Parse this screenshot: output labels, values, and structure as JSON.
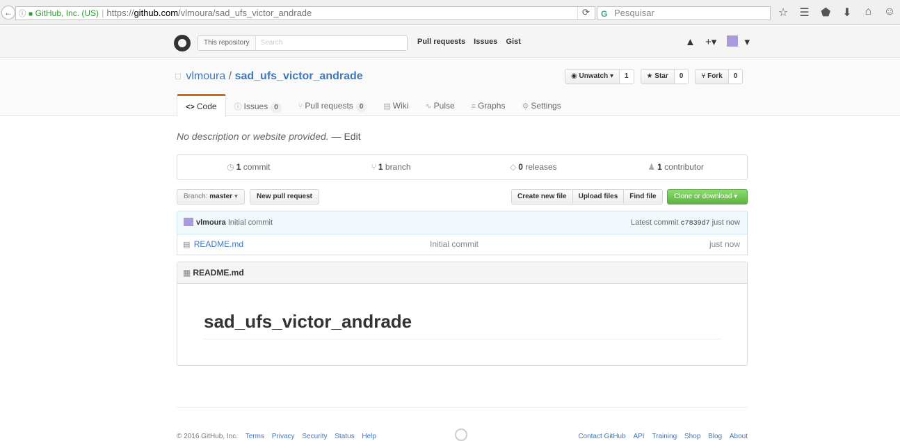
{
  "browser": {
    "back_icon": "back-arrow-icon",
    "info_icon": "ⓘ",
    "lock_icon": "🔒",
    "org": "GitHub, Inc. (US)",
    "url_prefix": "https://",
    "url_host": "github.com",
    "url_path": "/vlmoura/sad_ufs_victor_andrade",
    "reload": "⟳",
    "search_placeholder": "Pesquisar",
    "search_logo": "G",
    "toolbar_icons": [
      "☆",
      "☰",
      "⬟",
      "⬇",
      "⌂",
      "☺"
    ]
  },
  "gh_header": {
    "scope_label": "This repository",
    "search_placeholder": "Search",
    "nav": [
      "Pull requests",
      "Issues",
      "Gist"
    ],
    "bell": "🔔",
    "plus": "+▾",
    "avatar_caret": "▾"
  },
  "repo": {
    "owner": "vlmoura",
    "slash": "/",
    "name": "sad_ufs_victor_andrade",
    "book_icon": "□",
    "watch_label": "◉ Unwatch ▾",
    "watch_count": "1",
    "star_label": "★ Star",
    "star_count": "0",
    "fork_label": "⑂ Fork",
    "fork_count": "0"
  },
  "tabs": [
    {
      "icon": "<>",
      "label": "Code",
      "count": ""
    },
    {
      "icon": "ⓘ",
      "label": "Issues",
      "count": "0"
    },
    {
      "icon": "⑂",
      "label": "Pull requests",
      "count": "0"
    },
    {
      "icon": "▤",
      "label": "Wiki",
      "count": ""
    },
    {
      "icon": "∿",
      "label": "Pulse",
      "count": ""
    },
    {
      "icon": "≡",
      "label": "Graphs",
      "count": ""
    },
    {
      "icon": "⚙",
      "label": "Settings",
      "count": ""
    }
  ],
  "description": {
    "text": "No description or website provided.",
    "dash": " — ",
    "edit": "Edit"
  },
  "summary": [
    {
      "icon": "◷",
      "count": "1",
      "label": "commit"
    },
    {
      "icon": "⑂",
      "count": "1",
      "label": "branch"
    },
    {
      "icon": "◇",
      "count": "0",
      "label": "releases"
    },
    {
      "icon": "♟",
      "count": "1",
      "label": "contributor"
    }
  ],
  "file_nav": {
    "branch_prefix": "Branch: ",
    "branch": "master",
    "branch_caret": " ▾",
    "new_pr": "New pull request",
    "create_file": "Create new file",
    "upload": "Upload files",
    "find": "Find file",
    "clone": "Clone or download ▾"
  },
  "commit_tease": {
    "author": "vlmoura",
    "message": "Initial commit",
    "latest_label": "Latest commit ",
    "sha": "c7839d7",
    "age": " just now"
  },
  "files": [
    {
      "icon": "▤",
      "name": "README.md",
      "message": "Initial commit",
      "age": "just now"
    }
  ],
  "readme": {
    "icon": "▦",
    "title": "README.md",
    "heading": "sad_ufs_victor_andrade"
  },
  "footer": {
    "copyright": "© 2016 GitHub, Inc.",
    "left_links": [
      "Terms",
      "Privacy",
      "Security",
      "Status",
      "Help"
    ],
    "right_links": [
      "Contact GitHub",
      "API",
      "Training",
      "Shop",
      "Blog",
      "About"
    ]
  }
}
